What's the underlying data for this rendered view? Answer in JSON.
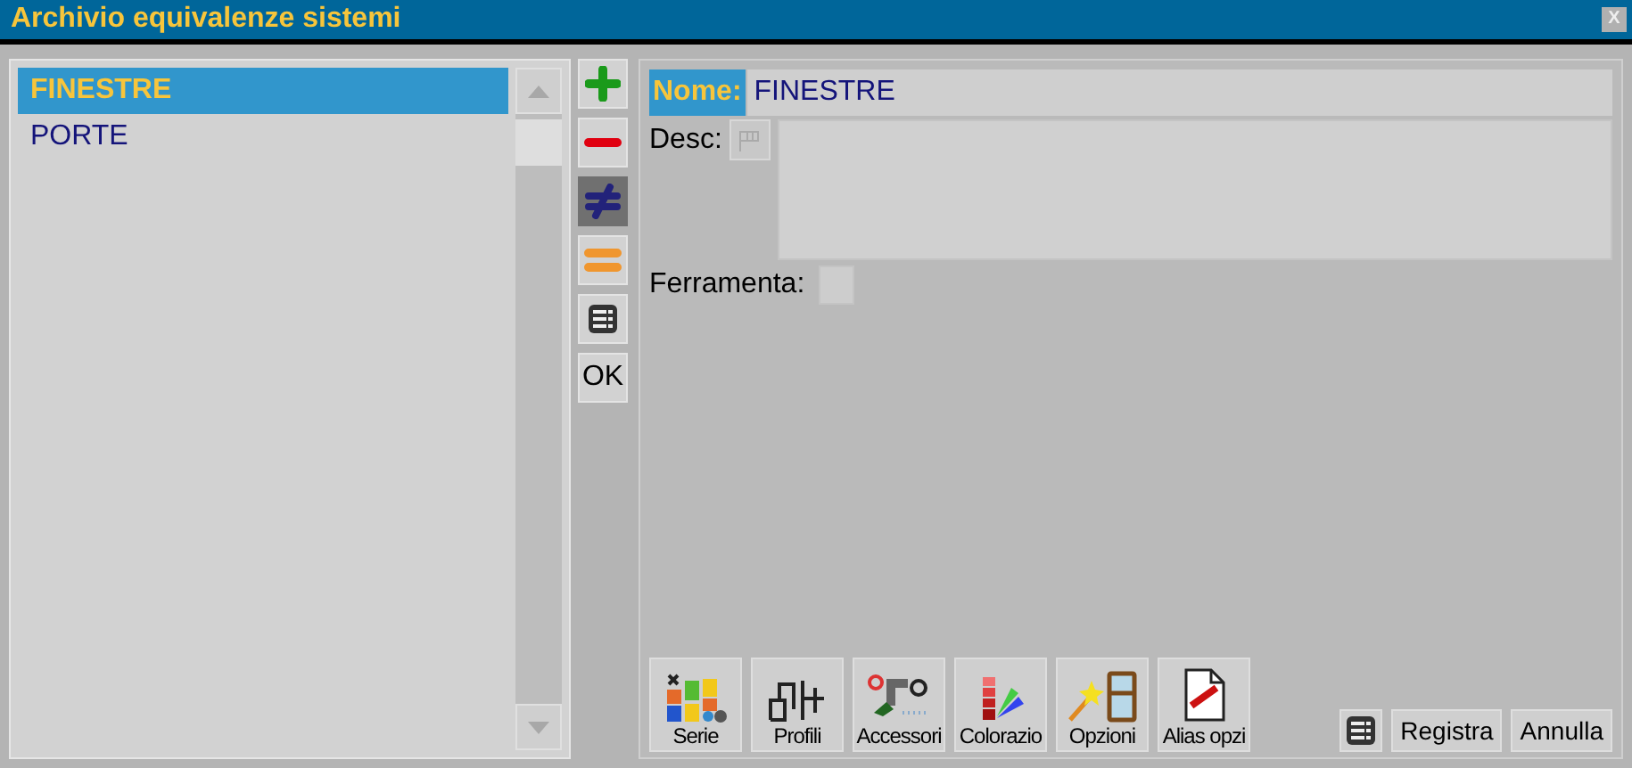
{
  "window": {
    "title": "Archivio equivalenze sistemi",
    "close": "X"
  },
  "list": {
    "items": [
      {
        "label": "FINESTRE",
        "selected": true
      },
      {
        "label": "PORTE",
        "selected": false
      }
    ]
  },
  "toolbar": [
    {
      "kind": "add",
      "pressed": false
    },
    {
      "kind": "remove",
      "pressed": false
    },
    {
      "kind": "swap",
      "pressed": true
    },
    {
      "kind": "equal",
      "pressed": false
    },
    {
      "kind": "table",
      "pressed": false
    },
    {
      "kind": "text",
      "label": "OK",
      "pressed": false
    }
  ],
  "form": {
    "name_label": "Nome:",
    "name_value": "FINESTRE",
    "desc_label": "Desc:",
    "hardware_label": "Ferramenta:"
  },
  "tiles": [
    {
      "kind": "serie",
      "label": "Serie"
    },
    {
      "kind": "profili",
      "label": "Profili"
    },
    {
      "kind": "accessori",
      "label": "Accessori"
    },
    {
      "kind": "colori",
      "label": "Colorazio"
    },
    {
      "kind": "opzioni",
      "label": "Opzioni"
    },
    {
      "kind": "alias",
      "label": "Alias opzi"
    }
  ],
  "footer": {
    "buttons": [
      "Registra",
      "Annulla"
    ]
  }
}
